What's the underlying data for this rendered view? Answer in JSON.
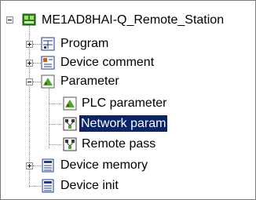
{
  "tree": {
    "root": {
      "label": "ME1AD8HAI-Q_Remote_Station",
      "expander": "minus",
      "icon": "station-icon"
    },
    "items": [
      {
        "label": "Program",
        "expander": "plus",
        "icon": "program-icon"
      },
      {
        "label": "Device comment",
        "expander": "plus",
        "icon": "device-comment-icon"
      },
      {
        "label": "Parameter",
        "expander": "minus",
        "icon": "parameter-icon",
        "children": [
          {
            "label": "PLC parameter",
            "icon": "plc-parameter-icon"
          },
          {
            "label": "Network param",
            "icon": "network-param-icon",
            "selected": true
          },
          {
            "label": "Remote pass",
            "icon": "remote-pass-icon"
          }
        ]
      },
      {
        "label": "Device memory",
        "expander": "plus",
        "icon": "device-memory-icon"
      },
      {
        "label": "Device init",
        "icon": "device-init-icon"
      }
    ]
  },
  "colors": {
    "selection": "#0a246a",
    "selection_text": "#ffffff",
    "border": "#7a7a7a"
  }
}
